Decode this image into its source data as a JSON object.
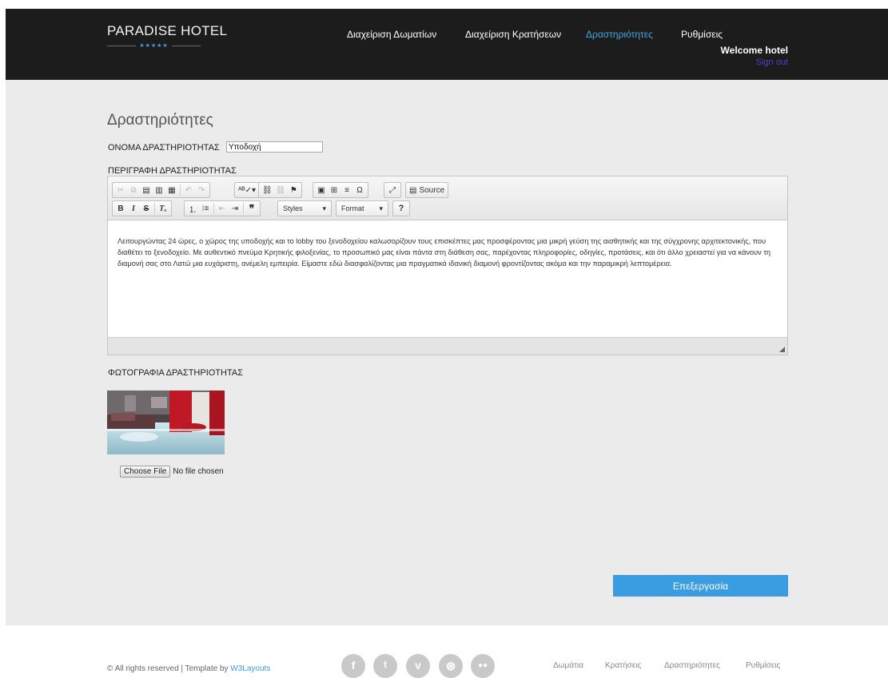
{
  "brand": {
    "name": "PARADISE HOTEL",
    "stars": "★★★★★"
  },
  "nav": {
    "rooms": "Διαχείριση Δωματίων",
    "bookings": "Διαχείριση Κρατήσεων",
    "activities": "Δραστηριότητες",
    "settings": "Ρυθμίσεις"
  },
  "user": {
    "welcome": "Welcome hotel",
    "signout": "Sign out"
  },
  "page": {
    "title": "Δραστηριότητες",
    "name_label": "ΟΝΟΜΑ ΔΡΑΣΤΗΡΙΟΤΗΤΑΣ",
    "name_value": "Υποδοχή",
    "desc_label": "ΠΕΡΙΓΡΑΦΗ ΔΡΑΣΤΗΡΙΟΤΗΤΑΣ",
    "photo_label": "ΦΩΤΟΓΡΑΦΙΑ ΔΡΑΣΤΗΡΙΟΤΗΤΑΣ",
    "submit": "Επεξεργασία"
  },
  "editor": {
    "source": "Source",
    "styles": "Styles",
    "format": "Format",
    "help": "?",
    "content": "Λειτουργώντας 24 ώρες, ο χώρος της υποδοχής και το lobby του ξενοδοχείου καλωσορίζουν τους επισκέπτες μας προσφέροντας μια μικρή γεύση της αισθητικής και της σύγχρονης αρχιτεκτονικής, που διαθέτει το ξενοδοχείο. Με αυθεντικό πνεύμα Κρητικής φιλοξενίας, το προσωπικό μας είναι πάντα στη διάθεση σας, παρέχοντας πληροφορίες, οδηγίες, προτάσεις, και ότι άλλο χρειαστεί για να κάνουν τη διαμονή σας στο Λατώ μια ευχάριστη, ανέμελη εμπειρία. Είμαστε εδώ διασφαλίζοντας μια πραγματικά ιδανική διαμονή φροντίζοντας ακόμα και την παραμικρή λεπτομέρεια."
  },
  "file": {
    "button": "Choose File",
    "status": "No file chosen"
  },
  "footer": {
    "copyright": "© All rights reserved | Template by ",
    "credit": "W3Layouts",
    "links": [
      "Δωμάτια",
      "Κρατήσεις",
      "Δραστηριότητες",
      "Ρυθμίσεις"
    ],
    "social": [
      "facebook-icon",
      "twitter-icon",
      "vimeo-icon",
      "dribbble-icon",
      "flickr-icon"
    ]
  },
  "colors": {
    "accent": "#3a9de2",
    "header": "#1c1c1c",
    "body": "#ebebeb",
    "signout": "#5b3bd2"
  }
}
